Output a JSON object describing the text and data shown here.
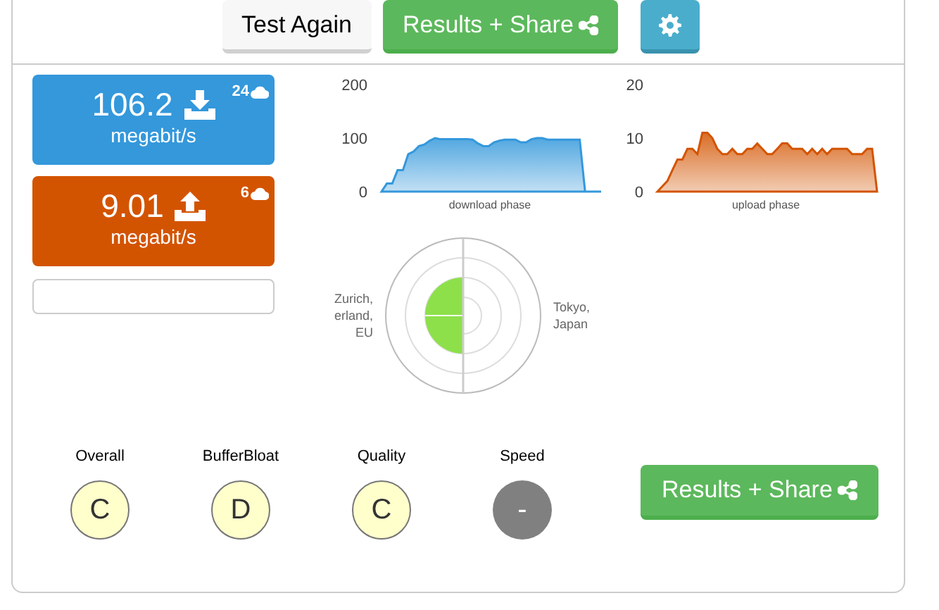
{
  "toolbar": {
    "test_again": "Test Again",
    "results_share": "Results + Share"
  },
  "speeds": [
    {
      "kind": "download",
      "value": "106.2",
      "unit": "megabit/s",
      "count": "24",
      "color": "#3498db"
    },
    {
      "kind": "upload",
      "value": "9.01",
      "unit": "megabit/s",
      "count": "6",
      "color": "#d35400"
    }
  ],
  "charts": [
    {
      "chart_data": {
        "type": "area",
        "xlabel": "download phase",
        "yticks": [
          0,
          100,
          200
        ],
        "ylim": [
          0,
          200
        ],
        "series": [
          {
            "color": "#3498db",
            "values": [
              0,
              15,
              15,
              40,
              40,
              70,
              75,
              85,
              88,
              95,
              100,
              98,
              98,
              98,
              98,
              98,
              98,
              97,
              90,
              85,
              85,
              92,
              95,
              97,
              97,
              97,
              92,
              92,
              98,
              100,
              100,
              97,
              97,
              97,
              97,
              97,
              97,
              97,
              0,
              0,
              0,
              0
            ]
          }
        ]
      }
    },
    {
      "chart_data": {
        "type": "area",
        "xlabel": "upload phase",
        "yticks": [
          0,
          10,
          20
        ],
        "ylim": [
          0,
          20
        ],
        "series": [
          {
            "color": "#d35400",
            "values": [
              0,
              1,
              2,
              4,
              6,
              6,
              8,
              8,
              7,
              11,
              11,
              10,
              8,
              7,
              7,
              8,
              7,
              7,
              8,
              8,
              9,
              8,
              7,
              7,
              8,
              9,
              9,
              8,
              8,
              8,
              7,
              8,
              7,
              8,
              7,
              8,
              8,
              8,
              8,
              7,
              7,
              7,
              8,
              8,
              0
            ]
          }
        ]
      }
    }
  ],
  "radar": {
    "left_label": [
      "Zurich,",
      "erland,",
      "EU"
    ],
    "right_label": [
      "Tokyo,",
      "Japan"
    ]
  },
  "grades": [
    {
      "label": "Overall",
      "grade": "C",
      "kind": "graded"
    },
    {
      "label": "BufferBloat",
      "grade": "D",
      "kind": "graded"
    },
    {
      "label": "Quality",
      "grade": "C",
      "kind": "graded"
    },
    {
      "label": "Speed",
      "grade": "-",
      "kind": "none"
    }
  ],
  "bottom_button": "Results + Share"
}
